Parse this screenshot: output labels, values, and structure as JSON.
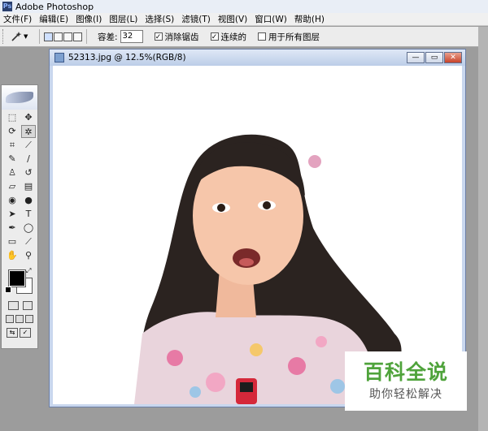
{
  "app": {
    "title": "Adobe Photoshop",
    "logo_text": "Ps"
  },
  "menu": [
    "文件(F)",
    "编辑(E)",
    "图像(I)",
    "图层(L)",
    "选择(S)",
    "滤镜(T)",
    "视图(V)",
    "窗口(W)",
    "帮助(H)"
  ],
  "options": {
    "tolerance_label": "容差:",
    "tolerance_value": "32",
    "anti_alias": {
      "label": "消除锯齿",
      "checked": true
    },
    "contiguous": {
      "label": "连续的",
      "checked": true
    },
    "sample_all_layers": {
      "label": "用于所有图层",
      "checked": false
    }
  },
  "document": {
    "title": "52313.jpg @ 12.5%(RGB/8)",
    "buttons": {
      "minimize": "—",
      "restore": "▭",
      "close": "✕"
    }
  },
  "toolbox": {
    "tools": [
      {
        "name": "marquee-tool-icon",
        "glyph": "⬚"
      },
      {
        "name": "move-tool-icon",
        "glyph": "✥"
      },
      {
        "name": "lasso-tool-icon",
        "glyph": "⟳"
      },
      {
        "name": "magic-wand-tool-icon",
        "glyph": "✲",
        "selected": true
      },
      {
        "name": "crop-tool-icon",
        "glyph": "⌗"
      },
      {
        "name": "slice-tool-icon",
        "glyph": "⟋"
      },
      {
        "name": "healing-brush-tool-icon",
        "glyph": "✎"
      },
      {
        "name": "brush-tool-icon",
        "glyph": "∕"
      },
      {
        "name": "clone-stamp-tool-icon",
        "glyph": "♙"
      },
      {
        "name": "history-brush-tool-icon",
        "glyph": "↺"
      },
      {
        "name": "eraser-tool-icon",
        "glyph": "▱"
      },
      {
        "name": "gradient-tool-icon",
        "glyph": "▤"
      },
      {
        "name": "blur-tool-icon",
        "glyph": "◉"
      },
      {
        "name": "dodge-tool-icon",
        "glyph": "●"
      },
      {
        "name": "path-selection-tool-icon",
        "glyph": "➤"
      },
      {
        "name": "type-tool-icon",
        "glyph": "T"
      },
      {
        "name": "pen-tool-icon",
        "glyph": "✒"
      },
      {
        "name": "shape-tool-icon",
        "glyph": "◯"
      },
      {
        "name": "notes-tool-icon",
        "glyph": "▭"
      },
      {
        "name": "eyedropper-tool-icon",
        "glyph": "⟋"
      },
      {
        "name": "hand-tool-icon",
        "glyph": "✋"
      },
      {
        "name": "zoom-tool-icon",
        "glyph": "⚲"
      }
    ],
    "foreground_color": "#000000",
    "background_color": "#ffffff"
  },
  "watermark": {
    "main": "百科全说",
    "sub": "助你轻松解决"
  }
}
